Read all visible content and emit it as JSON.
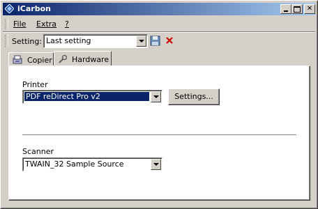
{
  "window": {
    "title": "iCarbon"
  },
  "menu": {
    "items": [
      "File",
      "Extra",
      "?"
    ]
  },
  "toolbar": {
    "setting_label": "Setting:",
    "setting_value": "Last setting"
  },
  "tabs": [
    {
      "label": "Copier"
    },
    {
      "label": "Hardware"
    }
  ],
  "printer": {
    "label": "Printer",
    "value": "PDF reDirect Pro v2",
    "settings_button": "Settings..."
  },
  "scanner": {
    "label": "Scanner",
    "value": "TWAIN_32 Sample Source"
  },
  "colors": {
    "titlebar_start": "#0a246a",
    "titlebar_end": "#a6caf0",
    "selection": "#0a246a",
    "delete": "#cc0000"
  },
  "icons": {
    "app": "carbon-diamond-icon",
    "save": "floppy-disk-icon",
    "delete": "red-x-icon",
    "copier": "copier-icon",
    "hardware": "wrench-icon"
  }
}
